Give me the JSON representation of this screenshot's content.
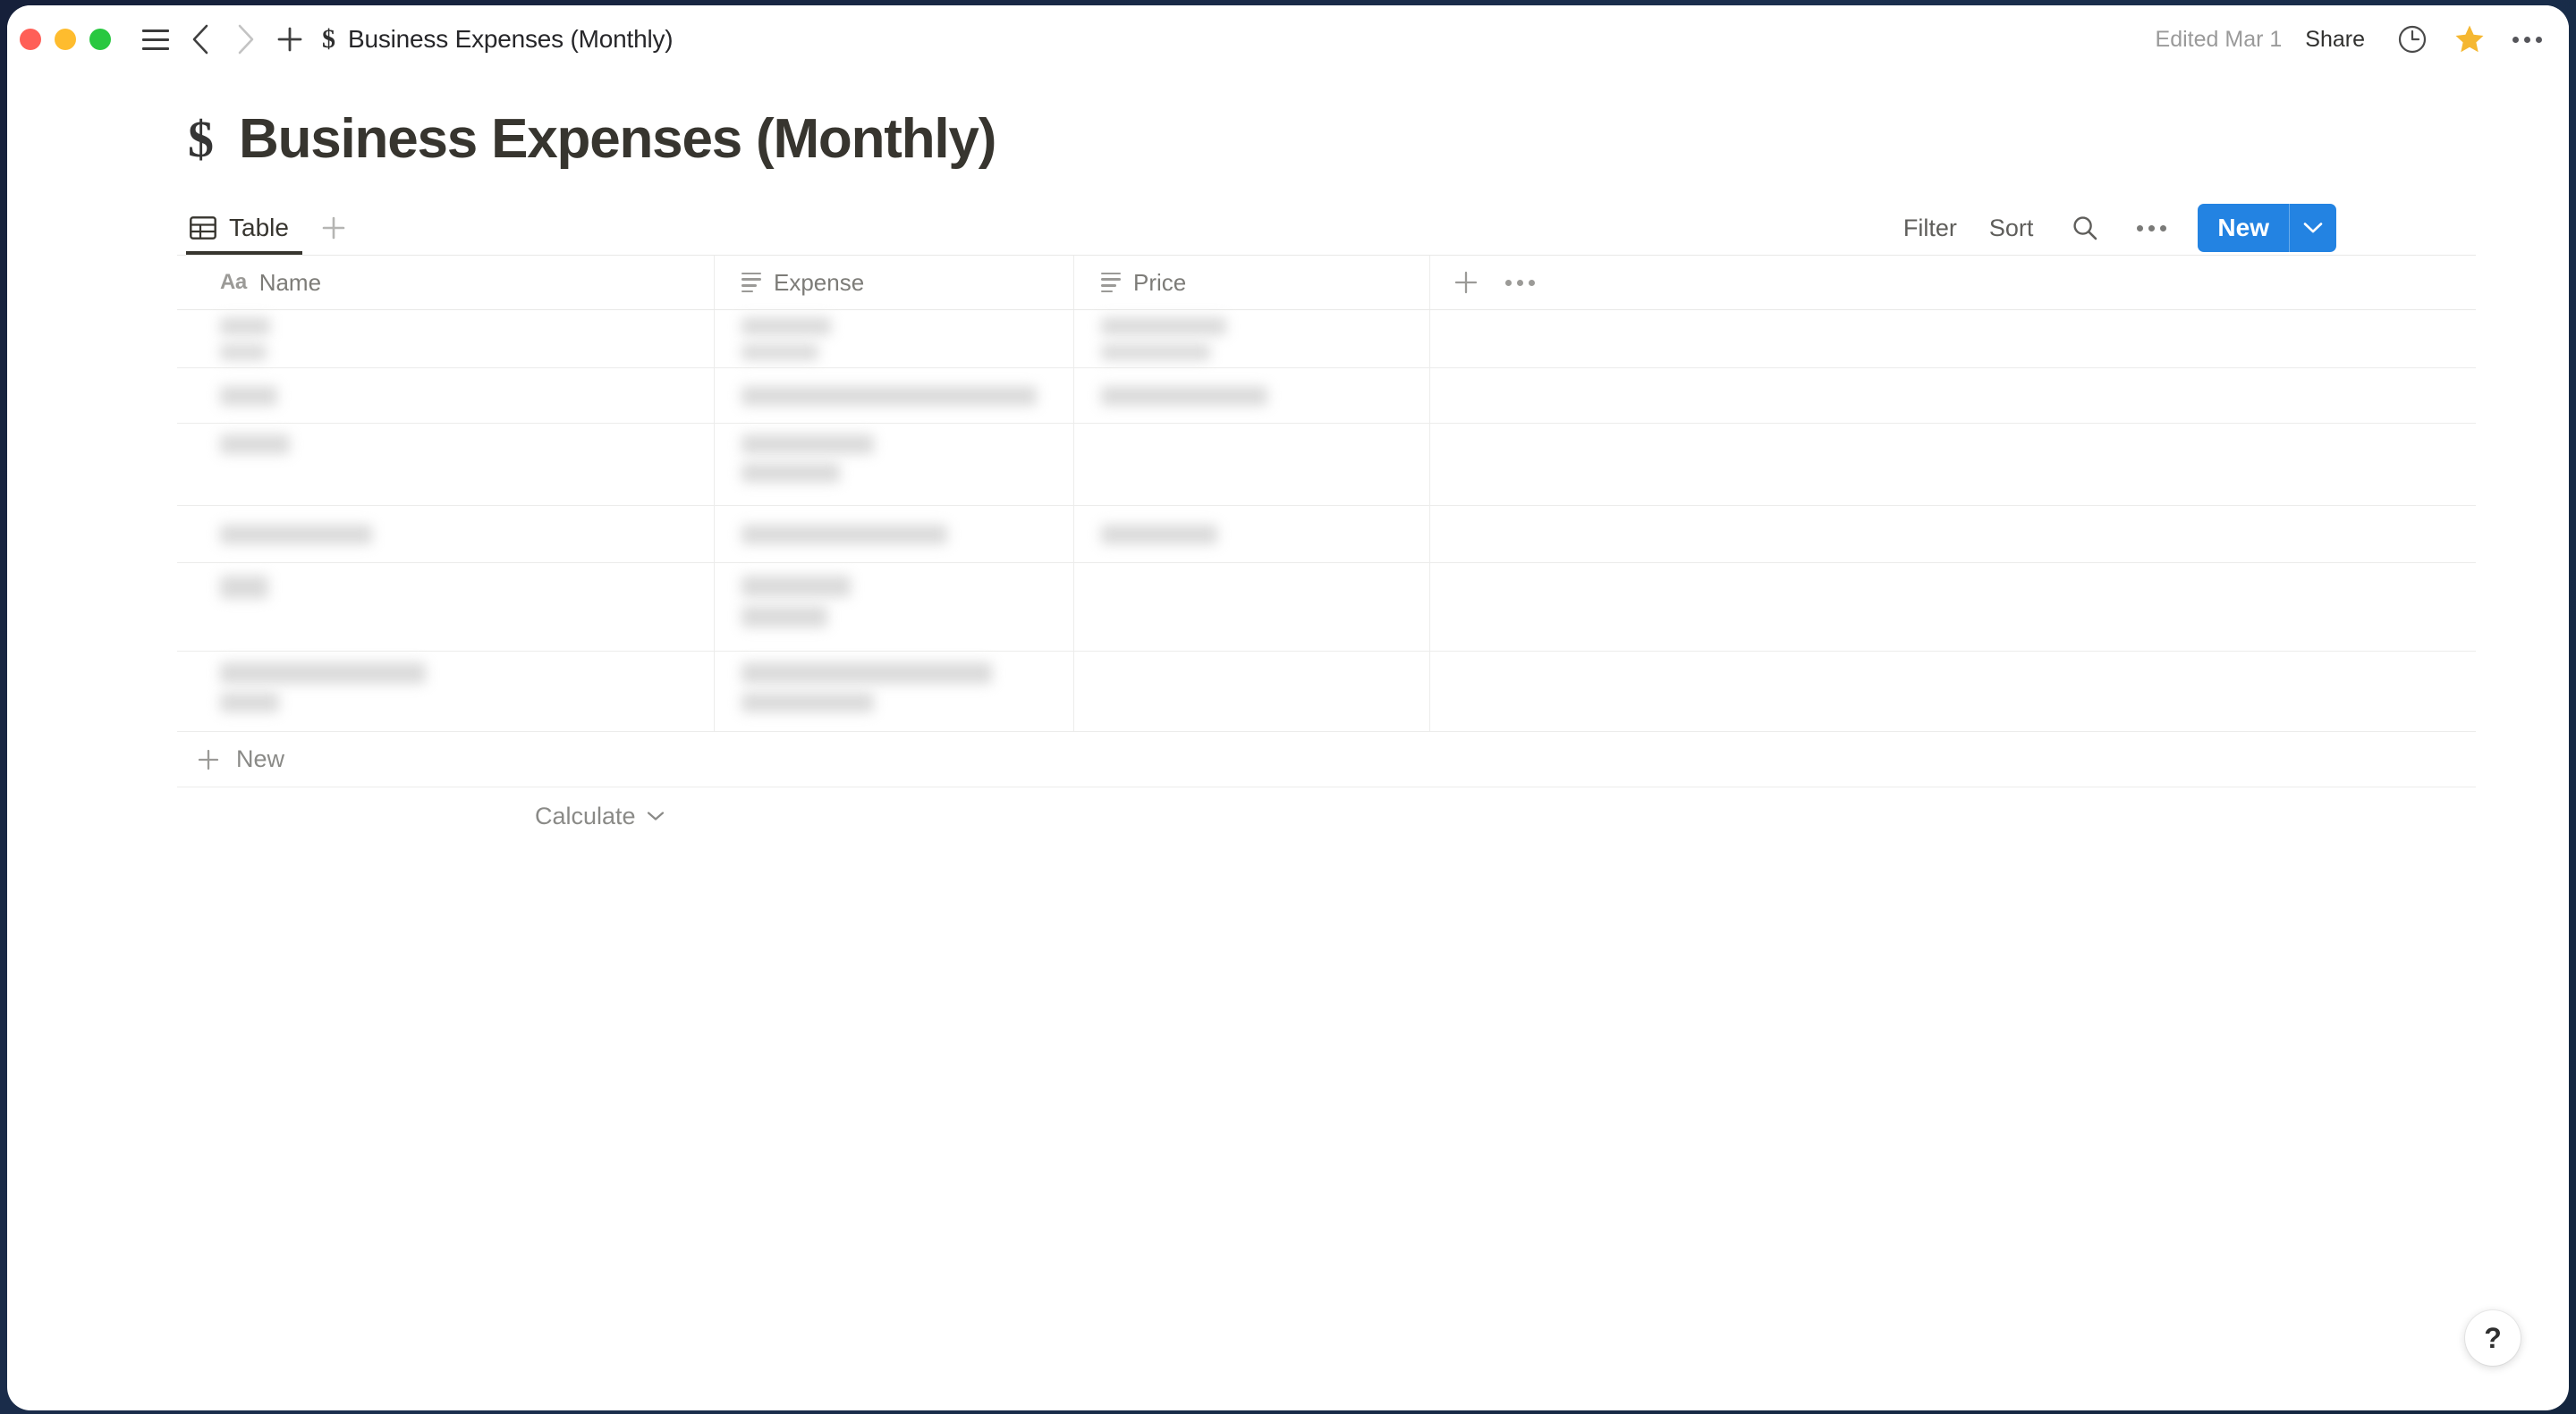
{
  "window": {
    "titlebar": {
      "emoji": "$",
      "title": "Business Expenses (Monthly)",
      "edited": "Edited Mar 1",
      "share_label": "Share",
      "icons": {
        "menu": "hamburger-icon",
        "back": "chevron-left-icon",
        "forward": "chevron-right-icon",
        "add": "plus-icon",
        "history": "clock-icon",
        "favorite": "star-icon",
        "more": "ellipsis-icon"
      }
    }
  },
  "page": {
    "emoji": "$",
    "title": "Business Expenses (Monthly)"
  },
  "view_tabs": {
    "tabs": [
      {
        "label": "Table",
        "icon": "table-icon",
        "active": true
      }
    ],
    "add_view_label": "+"
  },
  "toolbar": {
    "filter_label": "Filter",
    "sort_label": "Sort",
    "search_icon": "search-icon",
    "more_icon": "ellipsis-icon",
    "new_label": "New",
    "new_caret_icon": "chevron-down-icon",
    "accent_color": "#2383e2"
  },
  "table": {
    "columns": [
      {
        "label": "Name",
        "type_icon": "aa-text-icon",
        "type_label": "Aa"
      },
      {
        "label": "Expense",
        "type_icon": "text-lines-icon"
      },
      {
        "label": "Price",
        "type_icon": "text-lines-icon"
      }
    ],
    "header_controls": {
      "add_column_icon": "plus-icon",
      "more_icon": "ellipsis-icon"
    },
    "rows": [
      {
        "name_blocks": [
          [
            56,
            22
          ],
          [
            52,
            22
          ]
        ],
        "expense_blocks": [
          [
            100,
            22
          ],
          [
            86,
            22
          ]
        ],
        "price_blocks": [
          [
            140,
            22
          ],
          [
            122,
            22
          ]
        ]
      },
      {
        "name_blocks": [
          [
            64,
            22
          ]
        ],
        "expense_blocks": [
          [
            330,
            22
          ]
        ],
        "price_blocks": [
          [
            186,
            22
          ]
        ]
      },
      {
        "name_blocks": [
          [
            78,
            22
          ],
          [
            58,
            22
          ]
        ],
        "expense_blocks": [
          [
            148,
            22
          ],
          [
            110,
            22
          ]
        ],
        "price_blocks": []
      },
      {
        "name_blocks": [
          [
            170,
            22
          ]
        ],
        "expense_blocks": [
          [
            230,
            22
          ]
        ],
        "price_blocks": [
          [
            130,
            22
          ]
        ]
      },
      {
        "name_blocks": [
          [
            54,
            22
          ]
        ],
        "expense_blocks": [
          [
            122,
            22
          ],
          [
            96,
            22
          ]
        ],
        "price_blocks": []
      },
      {
        "name_blocks": [
          [
            230,
            22
          ],
          [
            66,
            22
          ]
        ],
        "expense_blocks": [
          [
            280,
            22
          ],
          [
            148,
            22
          ]
        ],
        "price_blocks": []
      }
    ],
    "new_row_label": "New",
    "new_row_icon": "plus-icon",
    "calculate_label": "Calculate",
    "calculate_caret_icon": "chevron-down-icon"
  },
  "help": {
    "label": "?",
    "icon": "question-mark-icon"
  }
}
